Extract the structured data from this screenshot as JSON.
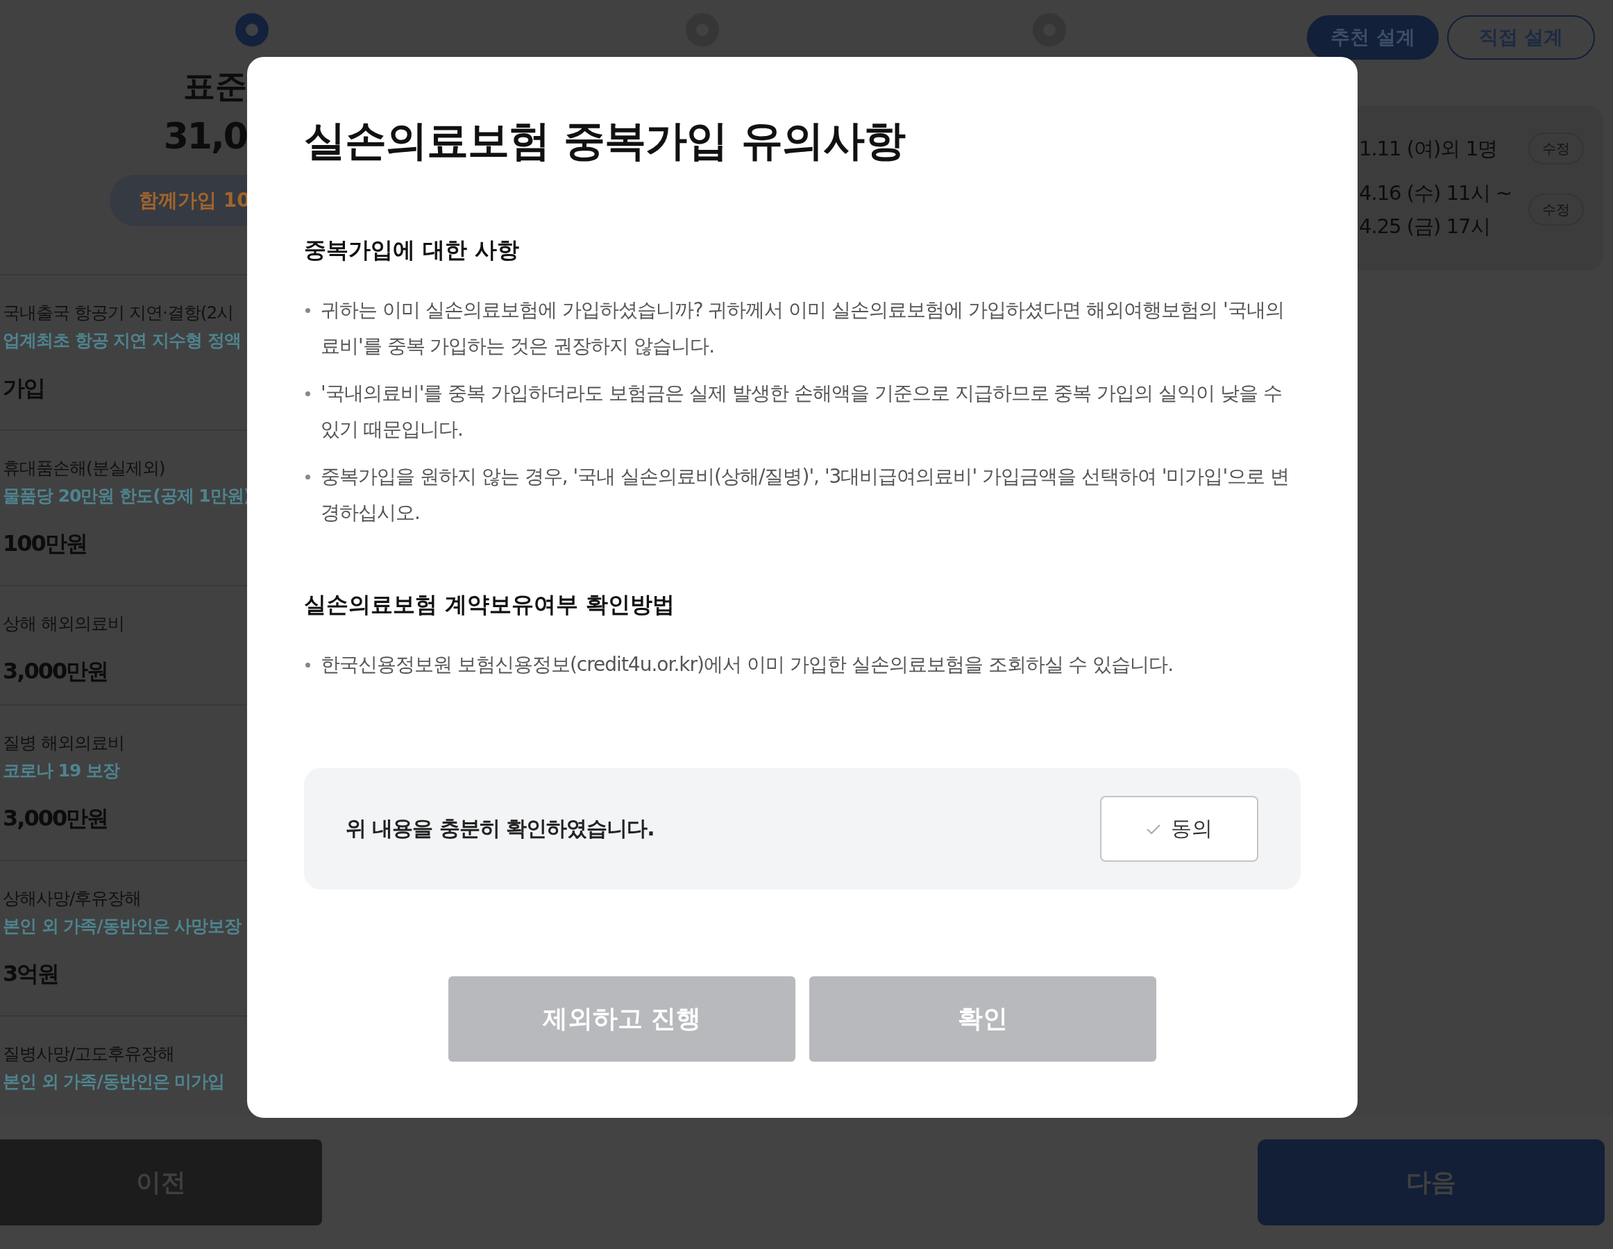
{
  "steps": [
    {
      "selected": true
    },
    {
      "selected": false
    },
    {
      "selected": false
    }
  ],
  "design_tabs": [
    {
      "label": "추천 설계",
      "selected": true
    },
    {
      "label": "직접 설계",
      "selected": false
    }
  ],
  "plan": {
    "name": "표준",
    "price": "31,0",
    "bundle": "함께가입 10"
  },
  "summary": [
    {
      "lines": [
        "1.11 (여)외 1명"
      ],
      "action": "수정"
    },
    {
      "lines": [
        "4.16 (수) 11시 ~",
        "4.25 (금) 17시"
      ],
      "action": "수정"
    }
  ],
  "coverages": [
    {
      "name": "국내출국 항공기 지연·결항(2시",
      "note": "업계최초 항공 지연 지수형 정액",
      "amount": "가입"
    },
    {
      "name": "휴대품손해(분실제외)",
      "note": "물품당 20만원 한도(공제 1만원)",
      "amount": "100만원"
    },
    {
      "name": "상해 해외의료비",
      "amount": "3,000만원"
    },
    {
      "name": "질병 해외의료비",
      "note": "코로나 19 보장",
      "amount": "3,000만원"
    },
    {
      "name": "상해사망/후유장해",
      "note": "본인 외 가족/동반인은 사망보장",
      "amount": "3억원"
    },
    {
      "name": "질병사망/고도후유장해",
      "note": "본인 외 가족/동반인은 미가입"
    }
  ],
  "modal": {
    "title": "실손의료보험 중복가입 유의사항",
    "sections": [
      {
        "heading": "중복가입에 대한 사항",
        "bullets": [
          "귀하는 이미 실손의료보험에 가입하셨습니까? 귀하께서 이미 실손의료보험에 가입하셨다면 해외여행보험의 '국내의료비'를 중복 가입하는 것은 권장하지 않습니다.",
          "'국내의료비'를 중복 가입하더라도 보험금은 실제 발생한 손해액을 기준으로 지급하므로 중복 가입의 실익이 낮을 수 있기 때문입니다.",
          "중복가입을 원하지 않는 경우, '국내 실손의료비(상해/질병)', '3대비급여의료비' 가입금액을 선택하여 '미가입'으로 변경하십시오."
        ]
      },
      {
        "heading": "실손의료보험 계약보유여부 확인방법",
        "bullets": [
          "한국신용정보원 보험신용정보(credit4u.or.kr)에서 이미 가입한 실손의료보험을 조회하실 수 있습니다."
        ]
      }
    ],
    "confirm": {
      "text": "위 내용을 충분히 확인하였습니다.",
      "button": "동의",
      "checked": false
    },
    "buttons": [
      {
        "label": "제외하고 진행",
        "disabled": true
      },
      {
        "label": "확인",
        "disabled": true
      }
    ]
  },
  "footer": {
    "prev": "이전",
    "next": "다음"
  }
}
